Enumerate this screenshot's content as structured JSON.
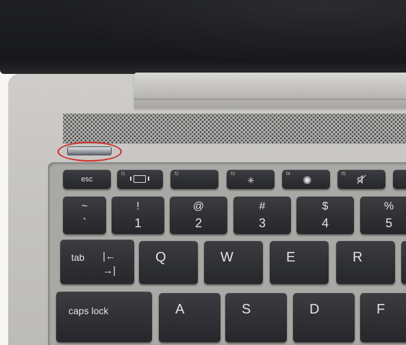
{
  "keyboard": {
    "function_row": [
      {
        "name": "esc",
        "label": "esc",
        "fn": ""
      },
      {
        "name": "f1",
        "label": "",
        "fn": "f1",
        "icon": "screen-switch-icon"
      },
      {
        "name": "f2",
        "label": "",
        "fn": "f2"
      },
      {
        "name": "f3",
        "label": "",
        "fn": "f3",
        "icon": "brightness-down-icon"
      },
      {
        "name": "f4",
        "label": "",
        "fn": "f4",
        "icon": "brightness-up-icon"
      },
      {
        "name": "f5",
        "label": "",
        "fn": "f5",
        "icon": "mute-icon"
      }
    ],
    "number_row": [
      {
        "top": "~",
        "bottom": "`"
      },
      {
        "top": "!",
        "bottom": "1"
      },
      {
        "top": "@",
        "bottom": "2"
      },
      {
        "top": "#",
        "bottom": "3"
      },
      {
        "top": "$",
        "bottom": "4"
      },
      {
        "top": "%",
        "bottom": "5"
      }
    ],
    "tab": {
      "label": "tab",
      "arrow_top": "|←",
      "arrow_bottom": "→|"
    },
    "qwerty": [
      "Q",
      "W",
      "E",
      "R"
    ],
    "caps": {
      "label": "caps lock"
    },
    "home_row": [
      "A",
      "S",
      "D",
      "F"
    ]
  },
  "highlight": {
    "color": "#d12a2a"
  }
}
